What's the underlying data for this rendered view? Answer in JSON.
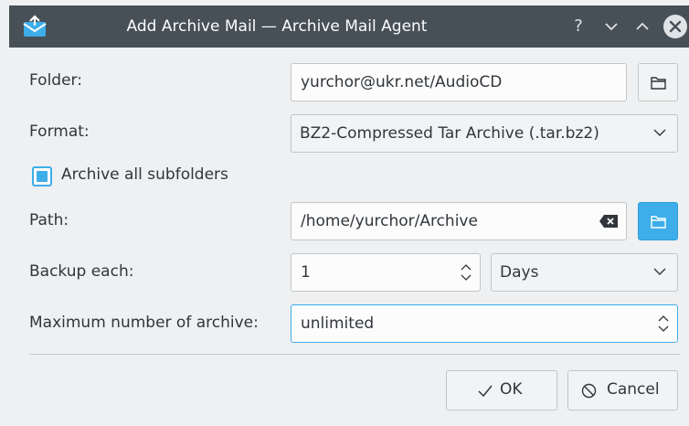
{
  "window": {
    "title": "Add Archive Mail — Archive Mail Agent",
    "controls": {
      "help": "?",
      "minimize": "⌄",
      "maximize": "⌃"
    }
  },
  "folder": {
    "label": "Folder:",
    "value": "yurchor@ukr.net/AudioCD"
  },
  "format": {
    "label": "Format:",
    "selected": "BZ2-Compressed Tar Archive (.tar.bz2)"
  },
  "subfolders": {
    "label": "Archive all subfolders",
    "checked": true
  },
  "path": {
    "label": "Path:",
    "value": "/home/yurchor/Archive"
  },
  "backup": {
    "label": "Backup each:",
    "value": "1",
    "unit": "Days"
  },
  "maximum": {
    "label": "Maximum number of archive:",
    "value": "unlimited"
  },
  "buttons": {
    "ok": "OK",
    "cancel": "Cancel"
  },
  "colors": {
    "titlebar": "#475057",
    "accent": "#3daee9",
    "background": "#eff0f1"
  }
}
